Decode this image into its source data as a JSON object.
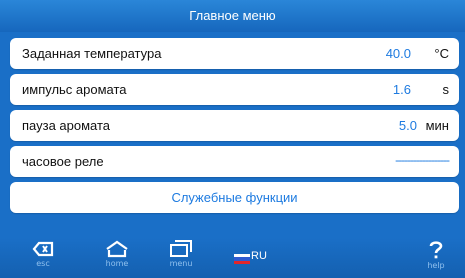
{
  "header": {
    "title": "Главное меню"
  },
  "rows": [
    {
      "label": "Заданная температура",
      "value": "40.0",
      "unit": "°C"
    },
    {
      "label": "импульс аромата",
      "value": "1.6",
      "unit": "s"
    },
    {
      "label": "пауза аромата",
      "value": "5.0",
      "unit": "мин"
    },
    {
      "label": "часовое реле",
      "value": "------------------"
    }
  ],
  "service": {
    "label": "Служебные функции"
  },
  "footer": {
    "esc": {
      "icon": "back-icon",
      "caption": "esc"
    },
    "home": {
      "icon": "home-icon",
      "caption": "home"
    },
    "menu": {
      "icon": "menu-icon",
      "caption": "menu"
    },
    "language": {
      "icon": "russia-flag-icon",
      "label": "RU"
    },
    "help": {
      "icon": "help-icon",
      "caption": "help"
    }
  },
  "colors": {
    "accent": "#1e7be0",
    "background": "#1a6fc7",
    "header": "#1667bd"
  }
}
